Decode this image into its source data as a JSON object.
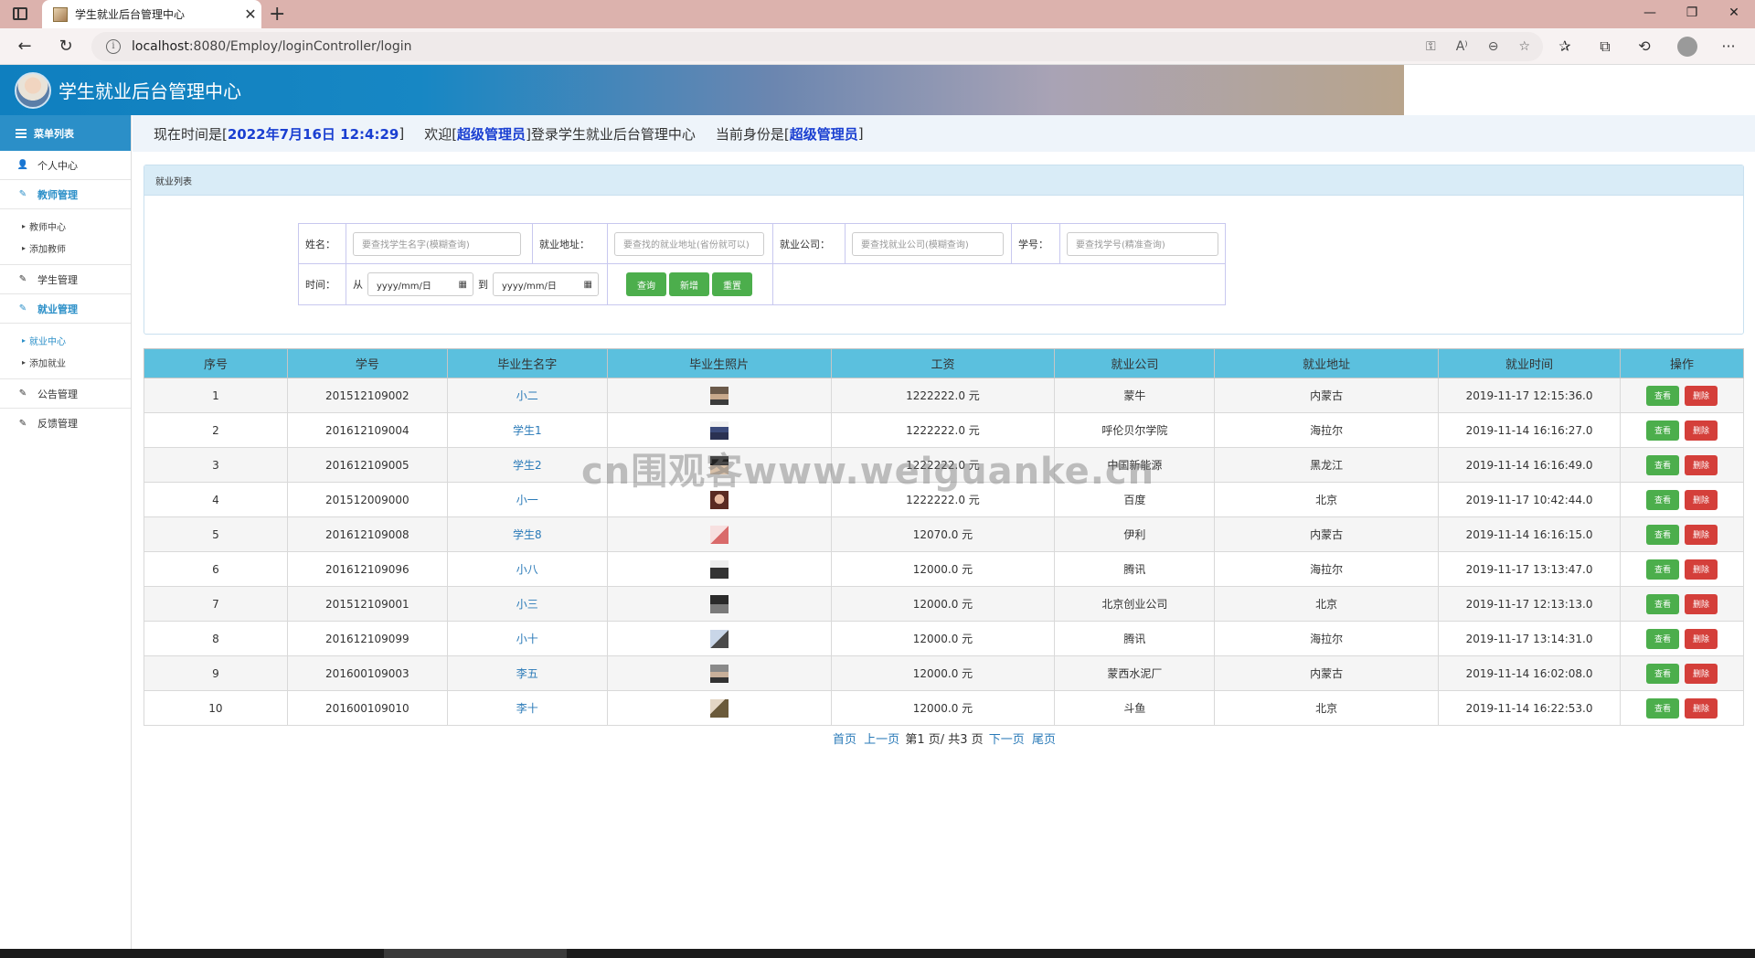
{
  "browser": {
    "tab_title": "学生就业后台管理中心",
    "tab_close": "✕",
    "new_tab": "+",
    "url_host": "localhost",
    "url_path": ":8080/Employ/loginController/login"
  },
  "app": {
    "title": "学生就业后台管理中心"
  },
  "sidebar": {
    "header": "菜单列表",
    "items": [
      {
        "label": "个人中心",
        "icon": "user-icon"
      },
      {
        "label": "教师管理",
        "icon": "edit-icon",
        "active": true,
        "sub": [
          "教师中心",
          "添加教师"
        ]
      },
      {
        "label": "学生管理",
        "icon": "edit-icon"
      },
      {
        "label": "就业管理",
        "icon": "edit-icon",
        "active": true,
        "sub": [
          "就业中心",
          "添加就业"
        ]
      },
      {
        "label": "公告管理",
        "icon": "edit-icon"
      },
      {
        "label": "反馈管理",
        "icon": "edit-icon"
      }
    ]
  },
  "infobar": {
    "time_prefix": "现在时间是[",
    "time_value": "2022年7月16日 12:4:29",
    "time_suffix": "]",
    "welcome_prefix": "欢迎[",
    "welcome_user": "超级管理员",
    "welcome_suffix": "]登录学生就业后台管理中心",
    "role_prefix": "当前身份是[",
    "role_value": "超级管理员",
    "role_suffix": "]"
  },
  "panel": {
    "title": "就业列表"
  },
  "search": {
    "name_label": "姓名：",
    "name_placeholder": "要查找学生名字(模糊查询)",
    "addr_label": "就业地址：",
    "addr_placeholder": "要查找的就业地址(省份就可以)",
    "company_label": "就业公司：",
    "company_placeholder": "要查找就业公司(模糊查询)",
    "sid_label": "学号：",
    "sid_placeholder": "要查找学号(精准查询)",
    "time_label": "时间：",
    "from_label": "从",
    "to_label": "到",
    "date_placeholder": "yyyy/mm/日",
    "btn_query": "查询",
    "btn_add": "新增",
    "btn_reset": "重置"
  },
  "table": {
    "headers": [
      "序号",
      "学号",
      "毕业生名字",
      "毕业生照片",
      "工资",
      "就业公司",
      "就业地址",
      "就业时间",
      "操作"
    ],
    "view_label": "查看",
    "delete_label": "删除",
    "rows": [
      {
        "no": "1",
        "sid": "201512109002",
        "name": "小二",
        "salary": "1222222.0 元",
        "company": "蒙牛",
        "addr": "内蒙古",
        "time": "2019-11-17 12:15:36.0"
      },
      {
        "no": "2",
        "sid": "201612109004",
        "name": "学生1",
        "salary": "1222222.0 元",
        "company": "呼伦贝尔学院",
        "addr": "海拉尔",
        "time": "2019-11-14 16:16:27.0"
      },
      {
        "no": "3",
        "sid": "201612109005",
        "name": "学生2",
        "salary": "1222222.0 元",
        "company": "中国新能源",
        "addr": "黑龙江",
        "time": "2019-11-14 16:16:49.0"
      },
      {
        "no": "4",
        "sid": "201512009000",
        "name": "小一",
        "salary": "1222222.0 元",
        "company": "百度",
        "addr": "北京",
        "time": "2019-11-17 10:42:44.0"
      },
      {
        "no": "5",
        "sid": "201612109008",
        "name": "学生8",
        "salary": "12070.0 元",
        "company": "伊利",
        "addr": "内蒙古",
        "time": "2019-11-14 16:16:15.0"
      },
      {
        "no": "6",
        "sid": "201612109096",
        "name": "小八",
        "salary": "12000.0 元",
        "company": "腾讯",
        "addr": "海拉尔",
        "time": "2019-11-17 13:13:47.0"
      },
      {
        "no": "7",
        "sid": "201512109001",
        "name": "小三",
        "salary": "12000.0 元",
        "company": "北京创业公司",
        "addr": "北京",
        "time": "2019-11-17 12:13:13.0"
      },
      {
        "no": "8",
        "sid": "201612109099",
        "name": "小十",
        "salary": "12000.0 元",
        "company": "腾讯",
        "addr": "海拉尔",
        "time": "2019-11-17 13:14:31.0"
      },
      {
        "no": "9",
        "sid": "201600109003",
        "name": "李五",
        "salary": "12000.0 元",
        "company": "蒙西水泥厂",
        "addr": "内蒙古",
        "time": "2019-11-14 16:02:08.0"
      },
      {
        "no": "10",
        "sid": "201600109010",
        "name": "李十",
        "salary": "12000.0 元",
        "company": "斗鱼",
        "addr": "北京",
        "time": "2019-11-14 16:22:53.0"
      }
    ]
  },
  "pager": {
    "first": "首页",
    "prev": "上一页",
    "status": "第1 页/ 共3 页",
    "next": "下一页",
    "last": "尾页"
  },
  "watermark": "cn围观客www.weiguanke.cn",
  "colors": {
    "header_blue": "#2b8fc8",
    "table_head": "#5bc0de",
    "green_btn": "#4cae4c",
    "red_btn": "#d43f3a",
    "highlight": "#1a3fd1"
  }
}
